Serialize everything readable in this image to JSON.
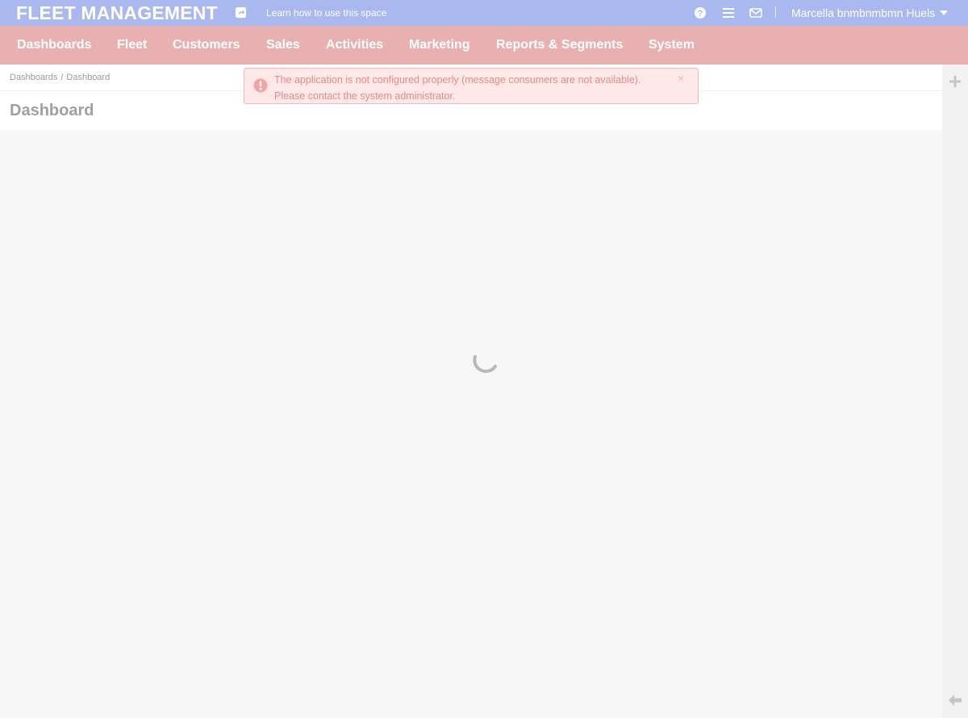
{
  "header": {
    "brand": "FLEET MANAGEMENT",
    "learn_link": "Learn how to use this space",
    "user_name": "Marcella bnmbnmbmn Huels",
    "icons": [
      "share-icon",
      "help-icon",
      "menu-icon",
      "envelope-icon",
      "caret-down-icon"
    ]
  },
  "nav": {
    "items": [
      "Dashboards",
      "Fleet",
      "Customers",
      "Sales",
      "Activities",
      "Marketing",
      "Reports & Segments",
      "System"
    ]
  },
  "breadcrumb": {
    "items": [
      "Dashboards",
      "Dashboard"
    ],
    "separator": "/"
  },
  "page": {
    "title": "Dashboard"
  },
  "alert": {
    "line1": "The application is not configured properly (message consumers are not available).",
    "line2": "Please contact the system administrator.",
    "close": "×",
    "icon": "exclamation-icon"
  },
  "right_rail": {
    "icons": [
      "plus-icon",
      "arrow-left-icon"
    ]
  },
  "colors": {
    "topbar": "#a9b8ef",
    "nav": "#e8b0b0",
    "alert_bg": "#fde8e8",
    "alert_text": "#e48a8a",
    "content_bg": "#f7f7f7"
  }
}
